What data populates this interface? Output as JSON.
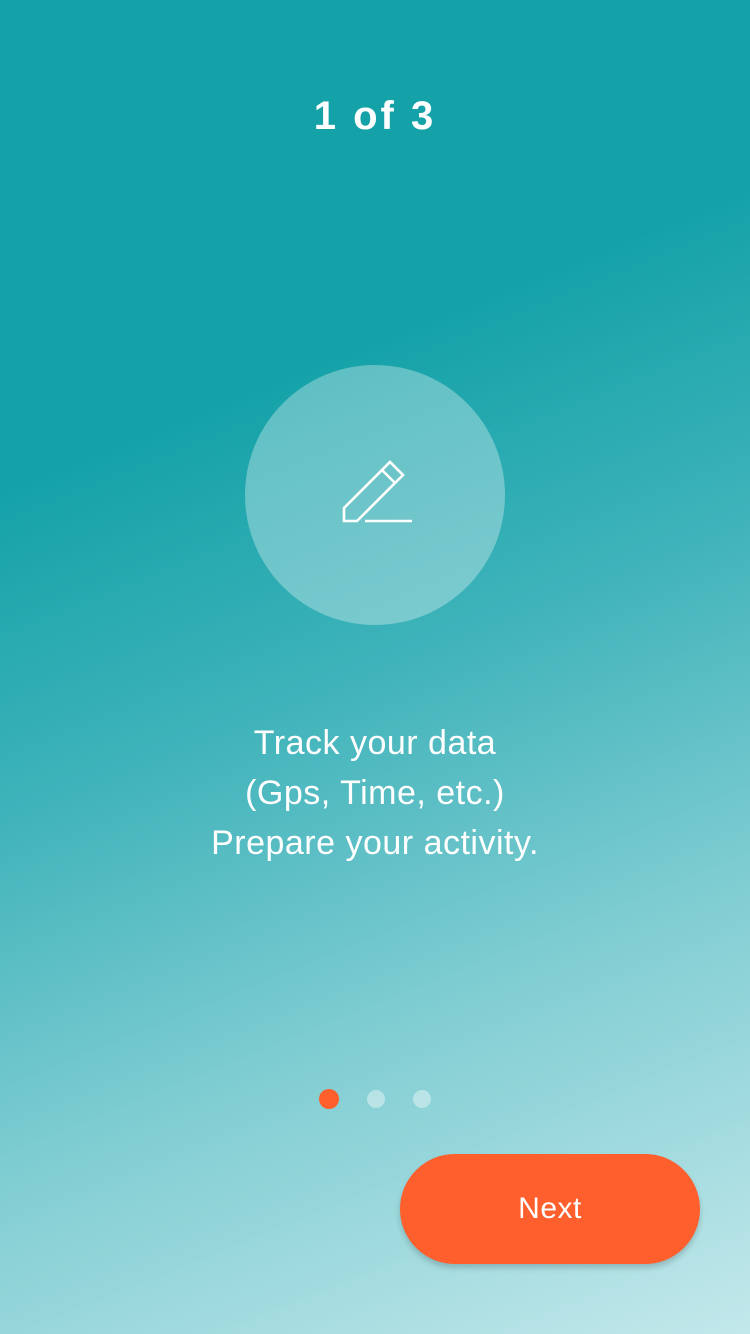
{
  "onboarding": {
    "step_label": "1 of 3",
    "icon": "pencil-icon",
    "description": [
      "Track your data",
      "(Gps, Time, etc.)",
      "Prepare your activity."
    ],
    "pagination": {
      "total": 3,
      "active_index": 0
    },
    "next_label": "Next"
  },
  "colors": {
    "background_top": "#14a2a8",
    "background_bottom": "#c3e8eb",
    "accent": "#ff5e2d",
    "text": "#ffffff"
  }
}
